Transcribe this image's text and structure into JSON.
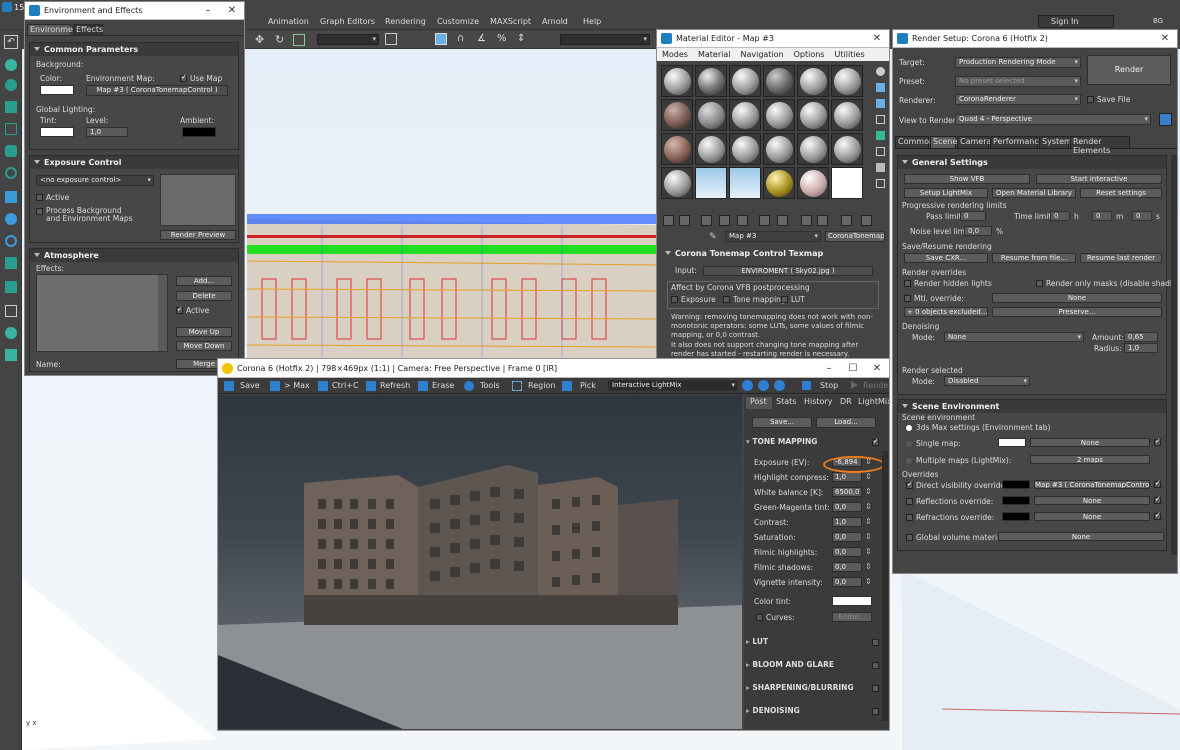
{
  "app": {
    "title_prefix": "15",
    "menu": [
      "Animation",
      "Graph Editors",
      "Rendering",
      "Customize",
      "MAXScript",
      "Arnold",
      "Help"
    ],
    "sign_in": "Sign In",
    "user_badge": "BG",
    "axis": "y x"
  },
  "env": {
    "title": "Environment and Effects",
    "tabs": [
      "Environment",
      "Effects"
    ],
    "common": {
      "header": "Common Parameters",
      "background": "Background:",
      "color": "Color:",
      "env_map": "Environment Map:",
      "use_map": "Use Map",
      "map_name": "Map #3  ( CoronaTonemapControl )",
      "global_lighting": "Global Lighting:",
      "tint": "Tint:",
      "level": "Level:",
      "level_value": "1,0",
      "ambient": "Ambient:"
    },
    "exposure": {
      "header": "Exposure Control",
      "select": "<no exposure control>",
      "active": "Active",
      "process_bg": "Process Background",
      "and_env": "and Environment Maps",
      "render_preview": "Render Preview"
    },
    "atmosphere": {
      "header": "Atmosphere",
      "effects": "Effects:",
      "add": "Add...",
      "delete": "Delete",
      "active": "Active",
      "move_up": "Move Up",
      "move_down": "Move Down",
      "name": "Name:",
      "merge": "Merge"
    }
  },
  "mat": {
    "title": "Material Editor - Map #3",
    "menu": [
      "Modes",
      "Material",
      "Navigation",
      "Options",
      "Utilities"
    ],
    "map_name": "Map #3",
    "map_type": "CoronaTonemap...",
    "section": "Corona Tonemap Control Texmap",
    "input_label": "Input:",
    "input_value": "ENVIROMENT ( Sky02.jpg )",
    "affect": "Affect by Corona VFB postprocessing",
    "exposure": "Exposure",
    "tone": "Tone mapping",
    "lut": "LUT",
    "warning": "Warning: removing tonemapping does not work with non-monotonic operators: some LUTs, some values of filmic mapping, or 0,0 contrast.",
    "note": "It also does not support changing tone mapping after render has started - restarting render is necessary."
  },
  "render": {
    "title": "Render Setup: Corona 6 (Hotfix 2)",
    "target": "Target:",
    "target_value": "Production Rendering Mode",
    "render_button": "Render",
    "preset": "Preset:",
    "preset_value": "No preset selected",
    "renderer": "Renderer:",
    "renderer_value": "CoronaRenderer",
    "save_file": "Save File",
    "view": "View to Render:",
    "view_value": "Quad 4 - Perspective",
    "tabs": [
      "Common",
      "Scene",
      "Camera",
      "Performance",
      "System",
      "Render Elements"
    ],
    "general": {
      "header": "General Settings",
      "show_vfb": "Show VFB",
      "start_interactive": "Start interactive",
      "setup_lightmix": "Setup LightMix",
      "open_library": "Open Material Library",
      "reset": "Reset settings",
      "progressive": "Progressive rendering limits",
      "pass_limit": "Pass limit:",
      "pass_value": "0",
      "time_limit": "Time limit:",
      "h_value": "0",
      "h": "h",
      "m_value": "0",
      "m": "m",
      "s_value": "0",
      "s": "s",
      "noise": "Noise level limit:",
      "noise_value": "0,0",
      "percent": "%",
      "save_resume": "Save/Resume rendering",
      "save_cxr": "Save CXR...",
      "resume_file": "Resume from file...",
      "resume_last": "Resume last render",
      "overrides": "Render overrides",
      "hidden_lights": "Render hidden lights",
      "only_masks": "Render only masks (disable shading)",
      "mtl_override": "Mtl. override:",
      "none": "None",
      "objects_excluded": "+ 0 objects excluded...",
      "preserve": "Preserve...",
      "denoising": "Denoising",
      "mode": "Mode:",
      "mode_value": "None",
      "amount": "Amount:",
      "amount_value": "0,65",
      "radius": "Radius:",
      "radius_value": "1,0",
      "render_selected": "Render selected",
      "rs_mode_value": "Disabled"
    },
    "scene_env": {
      "header": "Scene Environment",
      "env": "Scene environment",
      "max_settings": "3ds Max settings (Environment tab)",
      "single_map": "Single map:",
      "none": "None",
      "multiple_maps": "Multiple maps (LightMix):",
      "maps_count": "2 maps",
      "overrides": "Overrides",
      "direct": "Direct visibility override:",
      "direct_map": "Map #3  ( CoronaTonemapControl )",
      "reflections": "Reflections override:",
      "refractions": "Refractions override:",
      "gvm": "Global volume material:"
    }
  },
  "vfb": {
    "title": "Corona 6 (Hotfix 2) | 798×469px (1:1) | Camera: Free Perspective | Frame 0 [IR]",
    "toolbar": [
      "Save",
      "> Max",
      "Ctrl+C",
      "Refresh",
      "Erase",
      "Tools",
      "Region",
      "Pick"
    ],
    "lightmix": "Interactive LightMix",
    "stop": "Stop",
    "render": "Render",
    "tabs": [
      "Post",
      "Stats",
      "History",
      "DR",
      "LightMix"
    ],
    "save": "Save...",
    "load": "Load...",
    "tone_header": "TONE MAPPING",
    "params": [
      {
        "label": "Exposure (EV):",
        "value": "-6,894"
      },
      {
        "label": "Highlight compress:",
        "value": "1,0"
      },
      {
        "label": "White balance [K]:",
        "value": "6500,0"
      },
      {
        "label": "Green-Magenta tint:",
        "value": "0,0"
      },
      {
        "label": "Contrast:",
        "value": "1,0"
      },
      {
        "label": "Saturation:",
        "value": "0,0"
      },
      {
        "label": "Filmic highlights:",
        "value": "0,0"
      },
      {
        "label": "Filmic shadows:",
        "value": "0,0"
      },
      {
        "label": "Vignette intensity:",
        "value": "0,0"
      }
    ],
    "color_tint": "Color tint:",
    "curves": "Curves:",
    "editor": "Editor...",
    "sections": [
      "LUT",
      "BLOOM AND GLARE",
      "SHARPENING/BLURRING",
      "DENOISING"
    ]
  },
  "colors": {
    "accent": "#f07c1a"
  }
}
